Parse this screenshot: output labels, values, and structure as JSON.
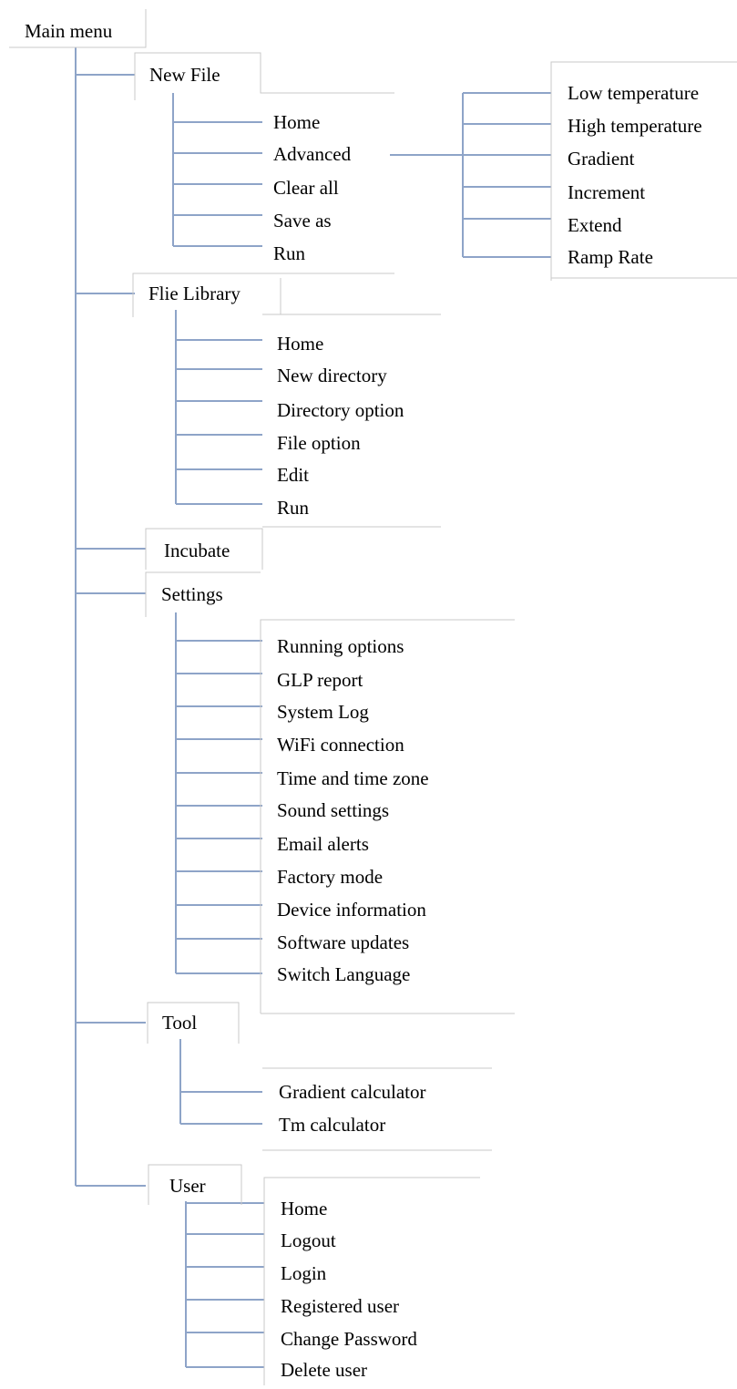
{
  "root": "Main menu",
  "colors": {
    "connector": "#8ea4c8",
    "box_border": "#c9c9c9",
    "text": "#000000"
  },
  "sections": {
    "new_file": {
      "title": "New File",
      "items": [
        "Home",
        "Advanced",
        "Clear all",
        "Save as",
        "Run"
      ],
      "advanced_items": [
        "Low temperature",
        "High temperature",
        "Gradient",
        "Increment",
        "Extend",
        "Ramp Rate"
      ]
    },
    "file_library": {
      "title": "Flie Library",
      "items": [
        "Home",
        "New directory",
        "Directory option",
        "File option",
        "Edit",
        "Run"
      ]
    },
    "incubate": {
      "title": "Incubate"
    },
    "settings": {
      "title": "Settings",
      "items": [
        "Running options",
        "GLP report",
        "System Log",
        "WiFi connection",
        "Time and time zone",
        "Sound settings",
        "Email alerts",
        "Factory mode",
        "Device information",
        "Software updates",
        "Switch Language"
      ]
    },
    "tool": {
      "title": "Tool",
      "items": [
        "Gradient calculator",
        "Tm calculator"
      ]
    },
    "user": {
      "title": "User",
      "items": [
        "Home",
        "Logout",
        "Login",
        "Registered user",
        "Change Password",
        "Delete user"
      ]
    }
  }
}
